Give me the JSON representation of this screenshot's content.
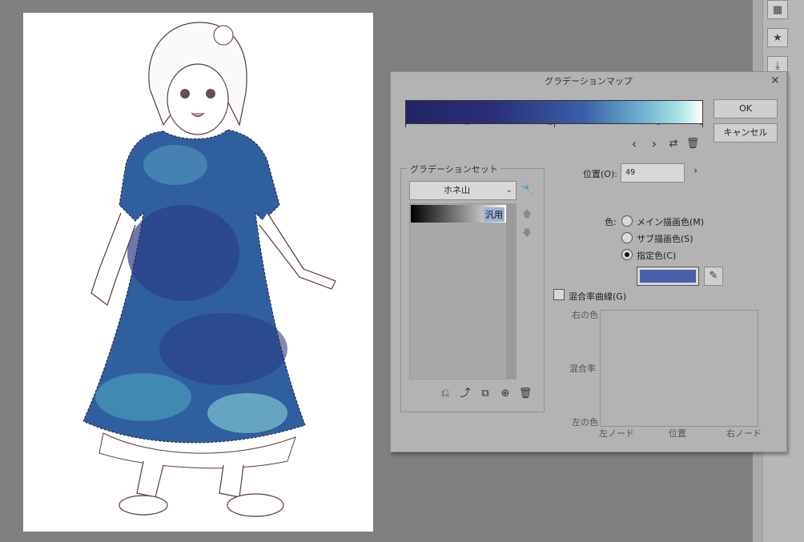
{
  "dialog": {
    "title": "グラデーションマップ",
    "ok_label": "OK",
    "cancel_label": "キャンセル",
    "gradient_set_title": "グラデーションセット",
    "gradient_set_selected": "ホネ山",
    "gradient_item_label": "汎用",
    "position_label": "位置(O):",
    "position_value": "49",
    "color_label": "色:",
    "radio_main": "メイン描画色(M)",
    "radio_sub": "サブ描画色(S)",
    "radio_custom": "指定色(C)",
    "selected_color": "#4960a8",
    "blend_curve_label": "混合率曲線(G)",
    "curve_right_color": "右の色",
    "curve_blend_rate": "混合率",
    "curve_left_color": "左の色",
    "curve_left_node": "左ノード",
    "curve_position": "位置",
    "curve_right_node": "右ノード"
  },
  "icons": {
    "close": "close-icon",
    "prev": "chevron-left-icon",
    "next": "chevron-right-icon",
    "flip": "flip-icon",
    "trash": "trash-icon",
    "wrench": "wrench-icon",
    "eyedropper": "eyedropper-icon"
  }
}
